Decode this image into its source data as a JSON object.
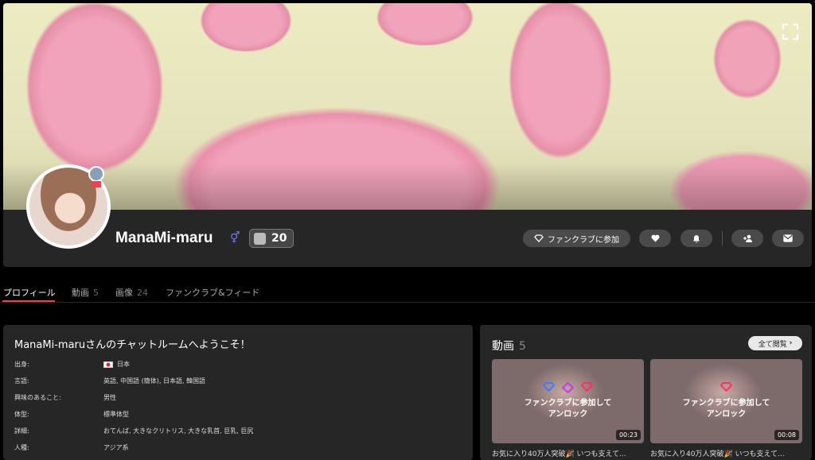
{
  "header": {
    "username": "ManaMi-maru",
    "level": "20",
    "join_fanclub_label": "ファンクラブに参加"
  },
  "tabs": [
    {
      "label": "プロフィール",
      "count": ""
    },
    {
      "label": "動画",
      "count": "5"
    },
    {
      "label": "画像",
      "count": "24"
    },
    {
      "label": "ファンクラブ&フィード",
      "count": ""
    }
  ],
  "profile": {
    "welcome": "ManaMi-maruさんのチャットルームへようこそ！",
    "rows": [
      {
        "label": "出身:",
        "value": "日本",
        "flag": "japan"
      },
      {
        "label": "言語:",
        "value": "英語, 中国語 (簡体), 日本語, 韓国語"
      },
      {
        "label": "興味のあること:",
        "value": "男性"
      },
      {
        "label": "体型:",
        "value": "標準体型"
      },
      {
        "label": "詳細:",
        "value": "おてんば, 大きなクリトリス, 大きな乳首, 巨乳, 巨尻"
      },
      {
        "label": "人種:",
        "value": "アジア系"
      }
    ]
  },
  "videos": {
    "title": "動画",
    "count": "5",
    "view_all": "全て閲覧",
    "items": [
      {
        "lock_line1": "ファンクラブに参加して",
        "lock_line2": "アンロック",
        "duration": "00:23",
        "caption": "お気に入り40万人突破🎉 いつも支えて..."
      },
      {
        "lock_line1": "ファンクラブに参加して",
        "lock_line2": "アンロック",
        "duration": "00:08",
        "caption": "お気に入り40万人突破🎉 いつも支えて..."
      }
    ]
  },
  "colors": {
    "accent": "#e8434e",
    "panel": "#262626",
    "button": "#4a4a4a"
  }
}
